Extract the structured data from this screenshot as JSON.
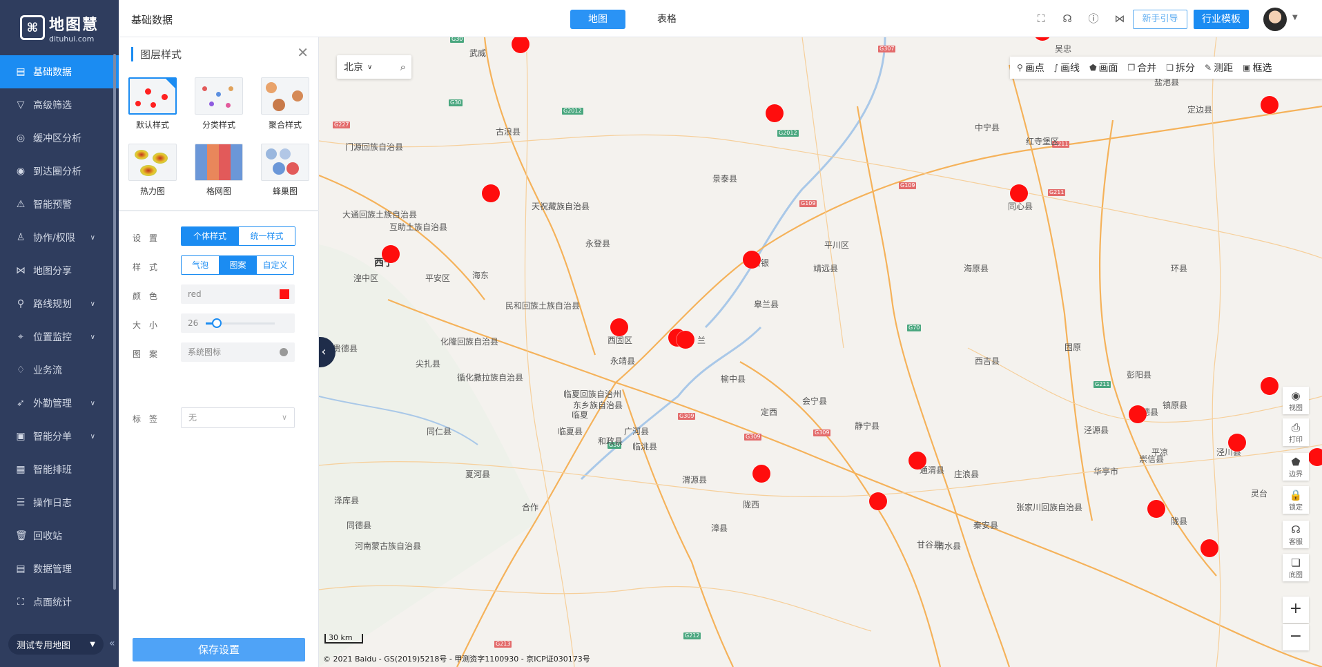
{
  "app": {
    "logo_cn": "地图慧",
    "logo_en": "dituhui.com",
    "page_title": "基础数据"
  },
  "sidebar": {
    "items": [
      {
        "label": "基础数据",
        "icon": "table-icon",
        "glyph": "▤",
        "active": true,
        "chevron": false
      },
      {
        "label": "高级筛选",
        "icon": "filter-icon",
        "glyph": "▽",
        "active": false,
        "chevron": false
      },
      {
        "label": "缓冲区分析",
        "icon": "buffer-icon",
        "glyph": "◎",
        "active": false,
        "chevron": false
      },
      {
        "label": "到达圈分析",
        "icon": "reach-circle-icon",
        "glyph": "◉",
        "active": false,
        "chevron": false
      },
      {
        "label": "智能预警",
        "icon": "alert-icon",
        "glyph": "⚠",
        "active": false,
        "chevron": false
      },
      {
        "label": "协作/权限",
        "icon": "user-icon",
        "glyph": "♙",
        "active": false,
        "chevron": true
      },
      {
        "label": "地图分享",
        "icon": "share-icon",
        "glyph": "⋈",
        "active": false,
        "chevron": false
      },
      {
        "label": "路线规划",
        "icon": "route-icon",
        "glyph": "⚲",
        "active": false,
        "chevron": true
      },
      {
        "label": "位置监控",
        "icon": "location-monitor-icon",
        "glyph": "⌖",
        "active": false,
        "chevron": true
      },
      {
        "label": "业务流",
        "icon": "flow-icon",
        "glyph": "♢",
        "active": false,
        "chevron": false
      },
      {
        "label": "外勤管理",
        "icon": "field-work-icon",
        "glyph": "➶",
        "active": false,
        "chevron": true
      },
      {
        "label": "智能分单",
        "icon": "dispatch-icon",
        "glyph": "▣",
        "active": false,
        "chevron": true
      },
      {
        "label": "智能排班",
        "icon": "schedule-icon",
        "glyph": "▦",
        "active": false,
        "chevron": false
      },
      {
        "label": "操作日志",
        "icon": "log-icon",
        "glyph": "☰",
        "active": false,
        "chevron": false
      },
      {
        "label": "回收站",
        "icon": "trash-icon",
        "glyph": "🗑",
        "active": false,
        "chevron": false
      },
      {
        "label": "数据管理",
        "icon": "data-manage-icon",
        "glyph": "▤",
        "active": false,
        "chevron": false
      },
      {
        "label": "点面统计",
        "icon": "point-stat-icon",
        "glyph": "⛶",
        "active": false,
        "chevron": false
      }
    ],
    "map_select": "测试专用地图",
    "collapse": "«"
  },
  "topbar": {
    "tabs": {
      "map": "地图",
      "table": "表格"
    },
    "guide_button": "新手引导",
    "industry_button": "行业模板"
  },
  "panel": {
    "title": "图层样式",
    "styles": [
      {
        "label": "默认样式",
        "selected": true
      },
      {
        "label": "分类样式",
        "selected": false
      },
      {
        "label": "聚合样式",
        "selected": false
      },
      {
        "label": "热力图",
        "selected": false
      },
      {
        "label": "格网图",
        "selected": false
      },
      {
        "label": "蜂巢图",
        "selected": false
      }
    ],
    "settings_label": "设置",
    "settings_options": [
      "个体样式",
      "统一样式"
    ],
    "style_label": "样式",
    "style_options": [
      "气泡",
      "图案",
      "自定义"
    ],
    "color_label": "颜色",
    "color_value": "red",
    "color_hex": "#ff1010",
    "size_label": "大小",
    "size_value": "26",
    "size_fraction": 0.16,
    "pattern_label": "图案",
    "pattern_value": "系统图标",
    "tag_label": "标签",
    "tag_value": "无",
    "save_button": "保存设置"
  },
  "map": {
    "city": "北京",
    "tools": [
      "画点",
      "画线",
      "画面",
      "合并",
      "拆分",
      "测距",
      "框选"
    ],
    "right_tools": [
      "视图",
      "打印",
      "边界",
      "锁定",
      "客服",
      "底图"
    ],
    "zoom_in": "+",
    "zoom_out": "−",
    "scale": "30 km",
    "copyright": "© 2021 Baidu - GS(2019)5218号 - 甲测资字1100930 - 京ICP证030173号",
    "places": [
      {
        "name": "武威"
      },
      {
        "name": "吴忠"
      },
      {
        "name": "盐池县"
      },
      {
        "name": "古浪县"
      },
      {
        "name": "中宁县"
      },
      {
        "name": "红寺堡区"
      },
      {
        "name": "门源回族自治县"
      },
      {
        "name": "景泰县"
      },
      {
        "name": "定边县"
      },
      {
        "name": "天祝藏族自治县"
      },
      {
        "name": "同心县"
      },
      {
        "name": "大通回族土族自治县"
      },
      {
        "name": "互助土族自治县"
      },
      {
        "name": "永登县"
      },
      {
        "name": "平川区"
      },
      {
        "name": "西宁",
        "city": true
      },
      {
        "name": "白银"
      },
      {
        "name": "靖远县"
      },
      {
        "name": "海原县"
      },
      {
        "name": "环县"
      },
      {
        "name": "湟中区"
      },
      {
        "name": "平安区"
      },
      {
        "name": "海东"
      },
      {
        "name": "皋兰县"
      },
      {
        "name": "民和回族土族自治县"
      },
      {
        "name": "西固区"
      },
      {
        "name": "兰"
      },
      {
        "name": "化隆回族自治县"
      },
      {
        "name": "固原"
      },
      {
        "name": "贵德县"
      },
      {
        "name": "西吉县"
      },
      {
        "name": "彭阳县"
      },
      {
        "name": "尖扎县"
      },
      {
        "name": "永靖县"
      },
      {
        "name": "榆中县"
      },
      {
        "name": "循化撒拉族自治县"
      },
      {
        "name": "临夏回族自治州"
      },
      {
        "name": "东乡族自治县"
      },
      {
        "name": "临夏"
      },
      {
        "name": "会宁县"
      },
      {
        "name": "镇原县"
      },
      {
        "name": "定西"
      },
      {
        "name": "隆德县"
      },
      {
        "name": "同仁县"
      },
      {
        "name": "静宁县"
      },
      {
        "name": "泾源县"
      },
      {
        "name": "临夏县"
      },
      {
        "name": "广河县"
      },
      {
        "name": "和政县"
      },
      {
        "name": "平凉"
      },
      {
        "name": "泾川县"
      },
      {
        "name": "崇信县"
      },
      {
        "name": "临洮县"
      },
      {
        "name": "通渭县"
      },
      {
        "name": "夏河县"
      },
      {
        "name": "庄浪县"
      },
      {
        "name": "华亭市"
      },
      {
        "name": "渭源县"
      },
      {
        "name": "灵台"
      },
      {
        "name": "泽库县"
      },
      {
        "name": "合作"
      },
      {
        "name": "陇西"
      },
      {
        "name": "张家川回族自治县"
      },
      {
        "name": "秦安县"
      },
      {
        "name": "陇县"
      },
      {
        "name": "漳县"
      },
      {
        "name": "甘谷县"
      },
      {
        "name": "清水县"
      },
      {
        "name": "同德县"
      },
      {
        "name": "河南蒙古族自治县"
      }
    ]
  }
}
